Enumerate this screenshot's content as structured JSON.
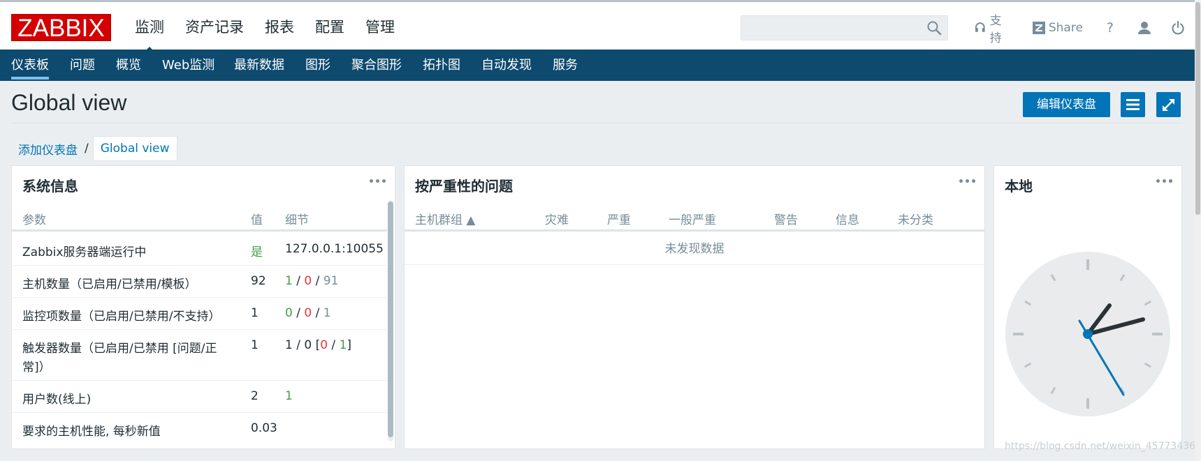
{
  "logo": "ZABBIX",
  "main_menu": [
    "监测",
    "资产记录",
    "报表",
    "配置",
    "管理"
  ],
  "top_actions": {
    "support": "支持",
    "share": "Share",
    "help": "?"
  },
  "sub_menu": [
    "仪表板",
    "问题",
    "概览",
    "Web监测",
    "最新数据",
    "图形",
    "聚合图形",
    "拓扑图",
    "自动发现",
    "服务"
  ],
  "page": {
    "title": "Global view",
    "edit_button": "编辑仪表盘"
  },
  "breadcrumb": {
    "parent": "添加仪表盘",
    "separator": "/",
    "current": "Global view"
  },
  "system_info": {
    "title": "系统信息",
    "headers": {
      "param": "参数",
      "value": "值",
      "detail": "细节"
    },
    "rows": [
      {
        "param": "Zabbix服务器端运行中",
        "value": "是",
        "detail": "127.0.0.1:10055"
      },
      {
        "param": "主机数量（已启用/已禁用/模板）",
        "value": "92",
        "d1": "1",
        "d2": "0",
        "d3": "91"
      },
      {
        "param": "监控项数量（已启用/已禁用/不支持）",
        "value": "1",
        "d1": "0",
        "d2": "0",
        "d3": "1"
      },
      {
        "param_line1": "触发器数量（已启用/已禁用 [问题/正",
        "param_line2": "常]）",
        "value": "1",
        "d_prefix": "1 / 0 [",
        "d1": "0",
        "d2": "1",
        "d_suffix": "]"
      },
      {
        "param": "用户数(线上)",
        "value": "2",
        "detail": "1"
      },
      {
        "param": "要求的主机性能, 每秒新值",
        "value": "0.03"
      }
    ]
  },
  "problems": {
    "title": "按严重性的问题",
    "headers": [
      "主机群组 ▲",
      "灾难",
      "严重",
      "一般严重",
      "警告",
      "信息",
      "未分类"
    ],
    "no_data": "未发现数据"
  },
  "clock": {
    "title": "本地"
  },
  "watermark": "https://blog.csdn.net/weixin_45773436"
}
